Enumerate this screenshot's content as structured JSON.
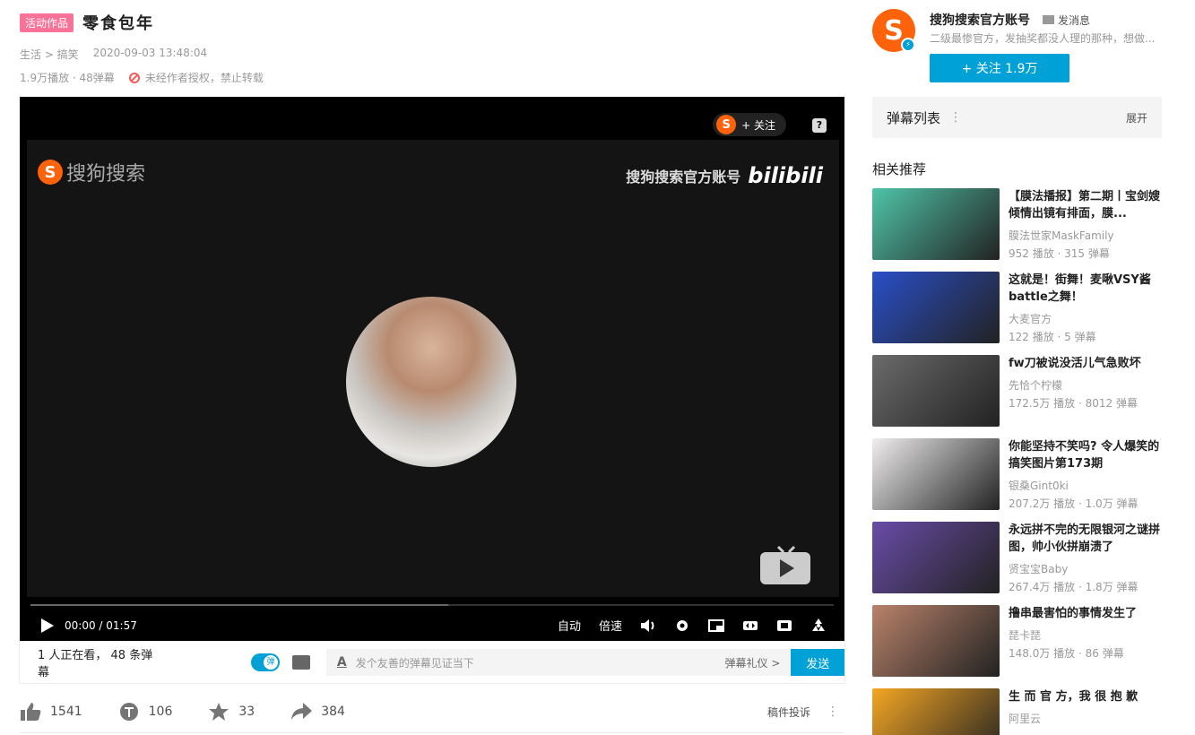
{
  "video": {
    "badge": "活动作品",
    "title": "零食包年",
    "category": "生活 > 搞笑",
    "date": "2020-09-03 13:48:04",
    "stats": "1.9万播放 · 48弹幕",
    "copyright": "未经作者授权，禁止转载"
  },
  "player": {
    "follow_label": "+ 关注",
    "help": "?",
    "watermark_left": "搜狗搜索",
    "watermark_right": "搜狗搜索官方账号",
    "bili": "bilibili",
    "time": "00:00 / 01:57",
    "auto_label": "自动",
    "speed_label": "倍速",
    "progress_buffered": 0.52
  },
  "danmaku_bar": {
    "watching": "1 人正在看， 48 条弹幕",
    "toggle_label": "弹",
    "placeholder": "发个友善的弹幕见证当下",
    "etiquette": "弹幕礼仪 >",
    "send": "发送"
  },
  "actions": {
    "like": "1541",
    "coin": "106",
    "fav": "33",
    "share": "384",
    "complain": "稿件投诉",
    "more": "⋮"
  },
  "uploader": {
    "name": "搜狗搜索官方账号",
    "message": "发消息",
    "desc": "二级最惨官方，发抽奖都没人理的那种，想做...",
    "follow": "+ 关注 1.9万",
    "avatar_letter": "S"
  },
  "danmaku_list": {
    "title": "弹幕列表",
    "dots": "⋮",
    "expand": "展开"
  },
  "recommend": {
    "title": "相关推荐",
    "items": [
      {
        "title": "【膜法播报】第二期丨宝剑嫂倾情出镜有排面，膜...",
        "up": "膜法世家MaskFamily",
        "stat": "952 播放 · 315 弹幕",
        "color": "#4fc4a8"
      },
      {
        "title": "这就是！街舞！麦啾VSY酱battle之舞！",
        "up": "大麦官方",
        "stat": "122 播放 · 5 弹幕",
        "color": "#2a4fc8"
      },
      {
        "title": "fw刀被说没活儿气急败坏",
        "up": "先恰个柠檬",
        "stat": "172.5万 播放 · 8012 弹幕",
        "color": "#6b6b6b"
      },
      {
        "title": "你能坚持不笑吗? 令人爆笑的搞笑图片第173期",
        "up": "银桑Gint0ki",
        "stat": "207.2万 播放 · 1.0万 弹幕",
        "color": "#f0eeee"
      },
      {
        "title": "永远拼不完的无限银河之谜拼图，帅小伙拼崩溃了",
        "up": "贤宝宝Baby",
        "stat": "267.4万 播放 · 1.8万 弹幕",
        "color": "#6a4ca8"
      },
      {
        "title": "撸串最害怕的事情发生了",
        "up": "琵卡琵",
        "stat": "148.0万 播放 · 86 弹幕",
        "color": "#b9826a"
      },
      {
        "title": "生 而 官 方，我 很 抱 歉",
        "up": "阿里云",
        "stat": "",
        "color": "#f5a623"
      }
    ]
  }
}
